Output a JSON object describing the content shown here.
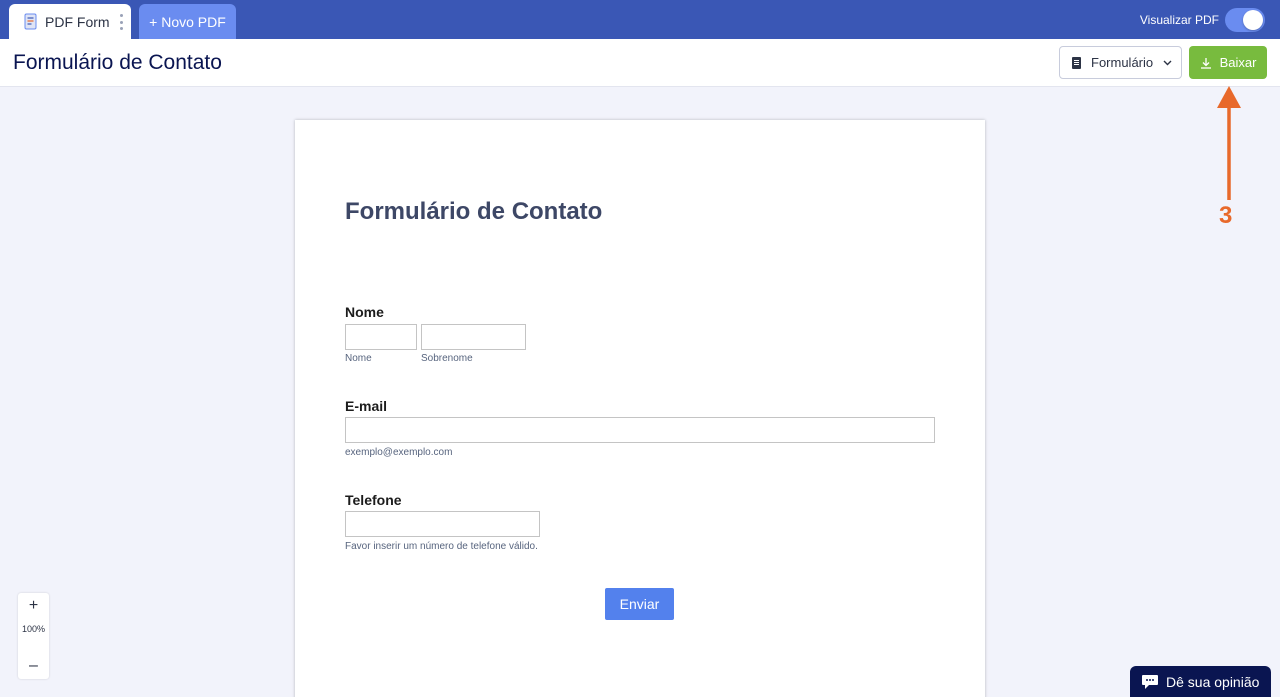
{
  "tabs": {
    "active_label": "PDF Form",
    "new_label": "+ Novo PDF"
  },
  "preview_toggle": {
    "label": "Visualizar PDF",
    "enabled": true
  },
  "header": {
    "title": "Formulário de Contato",
    "view_select": "Formulário",
    "download_label": "Baixar"
  },
  "annotation": {
    "step_number": "3",
    "color": "#e8692b"
  },
  "form": {
    "heading": "Formulário de Contato",
    "name_label": "Nome",
    "first_name_sublabel": "Nome",
    "last_name_sublabel": "Sobrenome",
    "email_label": "E-mail",
    "email_sublabel": "exemplo@exemplo.com",
    "phone_label": "Telefone",
    "phone_sublabel": "Favor inserir um número de telefone válido.",
    "submit_label": "Enviar"
  },
  "zoom": {
    "in_symbol": "+",
    "level": "100%",
    "out_symbol": "–"
  },
  "feedback": {
    "label": "Dê sua opinião"
  },
  "colors": {
    "topbar": "#3a57b5",
    "accent_blue": "#6a8cf0",
    "download_green": "#78bb3e",
    "submit_blue": "#5381ed",
    "feedback_navy": "#0a1551"
  }
}
